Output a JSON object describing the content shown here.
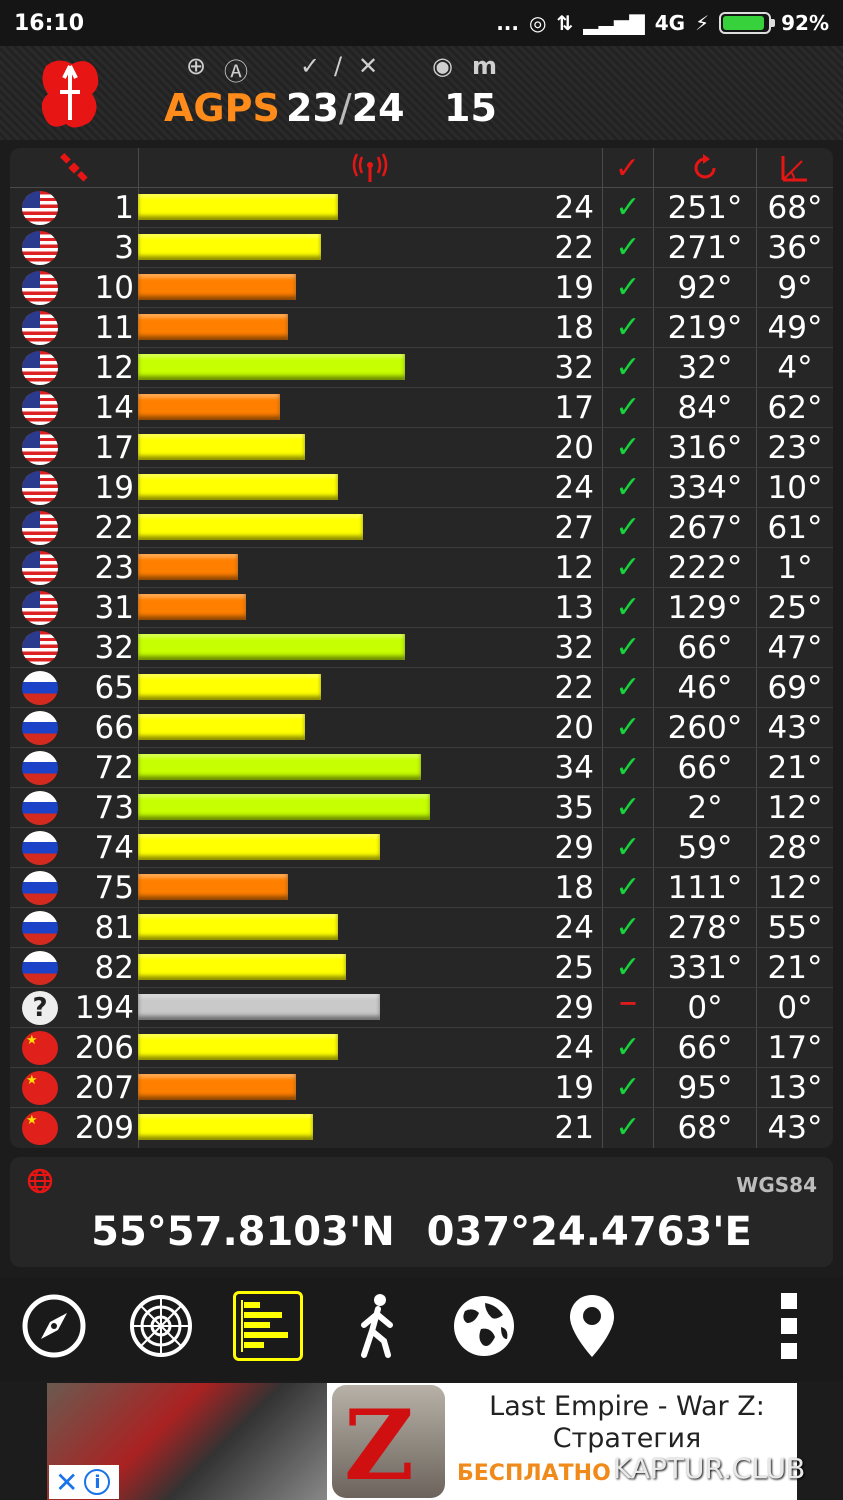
{
  "status_bar": {
    "time": "16:10",
    "dots": "...",
    "network": "4G",
    "battery": "92%",
    "battery_level": 0.92
  },
  "header": {
    "mode": "AGPS",
    "used": "23",
    "total": "24",
    "separator": "/",
    "accuracy": "15",
    "unit": "m"
  },
  "colors": {
    "yellow": "#ffff00",
    "orange": "#ff8000",
    "lime": "#c6ff00",
    "gray": "#c9c9c9",
    "check": "#19d23b",
    "red": "#e21b1b",
    "header_orange": "#ff8c1a"
  },
  "satellites": [
    {
      "flag": "us",
      "prn": "1",
      "snr": "24",
      "used": "✓",
      "az": "251°",
      "el": "68°",
      "snr_value": 24,
      "color": "#ffff00"
    },
    {
      "flag": "us",
      "prn": "3",
      "snr": "22",
      "used": "✓",
      "az": "271°",
      "el": "36°",
      "snr_value": 22,
      "color": "#ffff00"
    },
    {
      "flag": "us",
      "prn": "10",
      "snr": "19",
      "used": "✓",
      "az": "92°",
      "el": "9°",
      "snr_value": 19,
      "color": "#ff8000"
    },
    {
      "flag": "us",
      "prn": "11",
      "snr": "18",
      "used": "✓",
      "az": "219°",
      "el": "49°",
      "snr_value": 18,
      "color": "#ff8000"
    },
    {
      "flag": "us",
      "prn": "12",
      "snr": "32",
      "used": "✓",
      "az": "32°",
      "el": "4°",
      "snr_value": 32,
      "color": "#c6ff00"
    },
    {
      "flag": "us",
      "prn": "14",
      "snr": "17",
      "used": "✓",
      "az": "84°",
      "el": "62°",
      "snr_value": 17,
      "color": "#ff8000"
    },
    {
      "flag": "us",
      "prn": "17",
      "snr": "20",
      "used": "✓",
      "az": "316°",
      "el": "23°",
      "snr_value": 20,
      "color": "#ffff00"
    },
    {
      "flag": "us",
      "prn": "19",
      "snr": "24",
      "used": "✓",
      "az": "334°",
      "el": "10°",
      "snr_value": 24,
      "color": "#ffff00"
    },
    {
      "flag": "us",
      "prn": "22",
      "snr": "27",
      "used": "✓",
      "az": "267°",
      "el": "61°",
      "snr_value": 27,
      "color": "#ffff00"
    },
    {
      "flag": "us",
      "prn": "23",
      "snr": "12",
      "used": "✓",
      "az": "222°",
      "el": "1°",
      "snr_value": 12,
      "color": "#ff8000"
    },
    {
      "flag": "us",
      "prn": "31",
      "snr": "13",
      "used": "✓",
      "az": "129°",
      "el": "25°",
      "snr_value": 13,
      "color": "#ff8000"
    },
    {
      "flag": "us",
      "prn": "32",
      "snr": "32",
      "used": "✓",
      "az": "66°",
      "el": "47°",
      "snr_value": 32,
      "color": "#c6ff00"
    },
    {
      "flag": "ru",
      "prn": "65",
      "snr": "22",
      "used": "✓",
      "az": "46°",
      "el": "69°",
      "snr_value": 22,
      "color": "#ffff00"
    },
    {
      "flag": "ru",
      "prn": "66",
      "snr": "20",
      "used": "✓",
      "az": "260°",
      "el": "43°",
      "snr_value": 20,
      "color": "#ffff00"
    },
    {
      "flag": "ru",
      "prn": "72",
      "snr": "34",
      "used": "✓",
      "az": "66°",
      "el": "21°",
      "snr_value": 34,
      "color": "#c6ff00"
    },
    {
      "flag": "ru",
      "prn": "73",
      "snr": "35",
      "used": "✓",
      "az": "2°",
      "el": "12°",
      "snr_value": 35,
      "color": "#c6ff00"
    },
    {
      "flag": "ru",
      "prn": "74",
      "snr": "29",
      "used": "✓",
      "az": "59°",
      "el": "28°",
      "snr_value": 29,
      "color": "#ffff00"
    },
    {
      "flag": "ru",
      "prn": "75",
      "snr": "18",
      "used": "✓",
      "az": "111°",
      "el": "12°",
      "snr_value": 18,
      "color": "#ff8000"
    },
    {
      "flag": "ru",
      "prn": "81",
      "snr": "24",
      "used": "✓",
      "az": "278°",
      "el": "55°",
      "snr_value": 24,
      "color": "#ffff00"
    },
    {
      "flag": "ru",
      "prn": "82",
      "snr": "25",
      "used": "✓",
      "az": "331°",
      "el": "21°",
      "snr_value": 25,
      "color": "#ffff00"
    },
    {
      "flag": "unk",
      "prn": "194",
      "snr": "29",
      "used": "−",
      "az": "0°",
      "el": "0°",
      "snr_value": 29,
      "color": "#c9c9c9"
    },
    {
      "flag": "cn",
      "prn": "206",
      "snr": "24",
      "used": "✓",
      "az": "66°",
      "el": "17°",
      "snr_value": 24,
      "color": "#ffff00"
    },
    {
      "flag": "cn",
      "prn": "207",
      "snr": "19",
      "used": "✓",
      "az": "95°",
      "el": "13°",
      "snr_value": 19,
      "color": "#ff8000"
    },
    {
      "flag": "cn",
      "prn": "209",
      "snr": "21",
      "used": "✓",
      "az": "68°",
      "el": "43°",
      "snr_value": 21,
      "color": "#ffff00"
    }
  ],
  "snr_scale_max": 48,
  "position": {
    "datum": "WGS84",
    "lat": "55°57.8103'N",
    "lon": "037°24.4763'E"
  },
  "nav": [
    "compass-icon",
    "radar-icon",
    "signal-bars-icon",
    "walker-icon",
    "globe-icon",
    "map-pin-icon",
    "more-icon"
  ],
  "ad": {
    "title": "Last Empire - War Z: Стратегия",
    "free": "БЕСПЛАТНО",
    "watermark": "KAPTUR.CLUB"
  }
}
